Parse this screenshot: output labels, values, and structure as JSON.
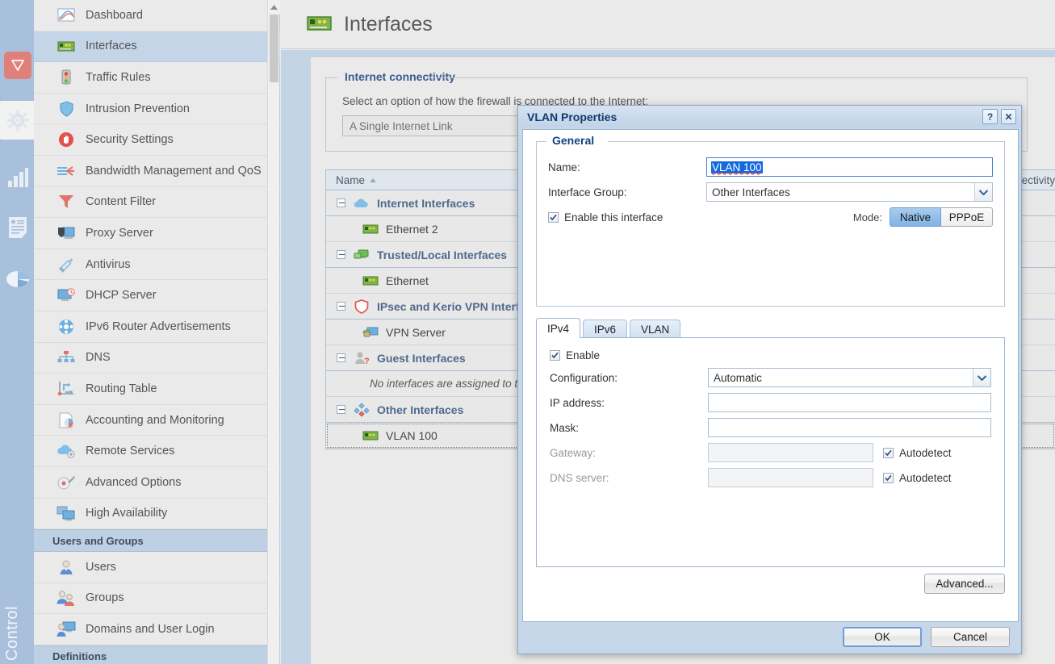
{
  "rail": {
    "icons": [
      {
        "name": "shield-icon",
        "label": "Configuration"
      },
      {
        "name": "gear-icon",
        "label": "Settings",
        "active": true
      },
      {
        "name": "bar-chart-icon",
        "label": "Status"
      },
      {
        "name": "logs-icon",
        "label": "Logs"
      },
      {
        "name": "pie-chart-icon",
        "label": "Statistics"
      }
    ],
    "vertical_label": "Control"
  },
  "sidebar": {
    "items": [
      {
        "label": "Dashboard",
        "icon": "dashboard-icon",
        "selected": false
      },
      {
        "label": "Interfaces",
        "icon": "network-card-icon",
        "selected": true
      },
      {
        "label": "Traffic Rules",
        "icon": "traffic-light-icon",
        "selected": false
      },
      {
        "label": "Intrusion Prevention",
        "icon": "shield-icon",
        "selected": false
      },
      {
        "label": "Security Settings",
        "icon": "stop-hand-icon",
        "selected": false
      },
      {
        "label": "Bandwidth Management and QoS",
        "icon": "bandwidth-icon",
        "selected": false
      },
      {
        "label": "Content Filter",
        "icon": "funnel-icon",
        "selected": false
      },
      {
        "label": "Proxy Server",
        "icon": "proxy-icon",
        "selected": false
      },
      {
        "label": "Antivirus",
        "icon": "syringe-icon",
        "selected": false
      },
      {
        "label": "DHCP Server",
        "icon": "dhcp-icon",
        "selected": false
      },
      {
        "label": "IPv6 Router Advertisements",
        "icon": "ipv6-router-icon",
        "selected": false
      },
      {
        "label": "DNS",
        "icon": "dns-tree-icon",
        "selected": false
      },
      {
        "label": "Routing Table",
        "icon": "routing-icon",
        "selected": false
      },
      {
        "label": "Accounting and Monitoring",
        "icon": "accounting-icon",
        "selected": false
      },
      {
        "label": "Remote Services",
        "icon": "cloud-gear-icon",
        "selected": false
      },
      {
        "label": "Advanced Options",
        "icon": "advanced-gear-icon",
        "selected": false
      },
      {
        "label": "High Availability",
        "icon": "high-availability-icon",
        "selected": false
      }
    ],
    "group_users_and_groups": "Users and Groups",
    "user_items": [
      {
        "label": "Users",
        "icon": "user-icon"
      },
      {
        "label": "Groups",
        "icon": "users-group-icon"
      },
      {
        "label": "Domains and User Login",
        "icon": "domain-user-icon"
      }
    ],
    "group_definitions": "Definitions"
  },
  "page": {
    "title": "Interfaces",
    "title_icon": "network-card-icon",
    "internet_connectivity": {
      "legend": "Internet connectivity",
      "description": "Select an option of how the firewall is connected to the Internet:",
      "selected_option": "A Single Internet Link"
    },
    "table": {
      "columns": [
        "Name",
        "Connectivity"
      ],
      "sort_column": "Name",
      "sort_direction": "ascending",
      "rows": [
        {
          "type": "group",
          "label": "Internet Interfaces",
          "icon": "cloud-icon",
          "expanded": true
        },
        {
          "type": "child",
          "label": "Ethernet 2",
          "icon": "network-card-icon"
        },
        {
          "type": "group",
          "label": "Trusted/Local Interfaces",
          "icon": "trusted-network-icon",
          "expanded": true
        },
        {
          "type": "child",
          "label": "Ethernet",
          "icon": "network-card-icon"
        },
        {
          "type": "group",
          "label": "IPsec and Kerio VPN Interfaces",
          "icon": "vpn-shield-icon",
          "expanded": true
        },
        {
          "type": "child",
          "label": "VPN Server",
          "icon": "vpn-server-icon"
        },
        {
          "type": "group",
          "label": "Guest Interfaces",
          "icon": "guest-user-icon",
          "expanded": true
        },
        {
          "type": "empty",
          "label": "No interfaces are assigned to this group."
        },
        {
          "type": "group",
          "label": "Other Interfaces",
          "icon": "other-interfaces-icon",
          "expanded": true
        },
        {
          "type": "child",
          "label": "VLAN 100",
          "icon": "network-card-icon",
          "focused": true
        }
      ]
    }
  },
  "dialog": {
    "title": "VLAN Properties",
    "help_button": "?",
    "close_button": "✕",
    "general": {
      "legend": "General",
      "name_label": "Name:",
      "name_value": "VLAN 100",
      "name_selected": true,
      "interface_group_label": "Interface Group:",
      "interface_group_value": "Other Interfaces",
      "enable_label": "Enable this interface",
      "enable_checked": true,
      "mode_label": "Mode:",
      "mode_options": [
        "Native",
        "PPPoE"
      ],
      "mode_selected": "Native"
    },
    "tabs": [
      {
        "label": "IPv4",
        "active": true
      },
      {
        "label": "IPv6",
        "active": false
      },
      {
        "label": "VLAN",
        "active": false
      }
    ],
    "ipv4": {
      "enable_label": "Enable",
      "enable_checked": true,
      "configuration_label": "Configuration:",
      "configuration_value": "Automatic",
      "ip_address_label": "IP address:",
      "ip_address_value": "",
      "mask_label": "Mask:",
      "mask_value": "",
      "gateway_label": "Gateway:",
      "gateway_value": "",
      "gateway_autodetect_label": "Autodetect",
      "gateway_autodetect_checked": true,
      "dns_label": "DNS server:",
      "dns_value": "",
      "dns_autodetect_label": "Autodetect",
      "dns_autodetect_checked": true,
      "advanced_button": "Advanced..."
    },
    "footer": {
      "ok": "OK",
      "cancel": "Cancel"
    }
  },
  "colors": {
    "accent_blue": "#4f6a8c",
    "rail_bg": "#a9c0dc",
    "selection": "#1569e0",
    "dialog_title": "#123a6d",
    "shield_red": "#e0807a"
  }
}
